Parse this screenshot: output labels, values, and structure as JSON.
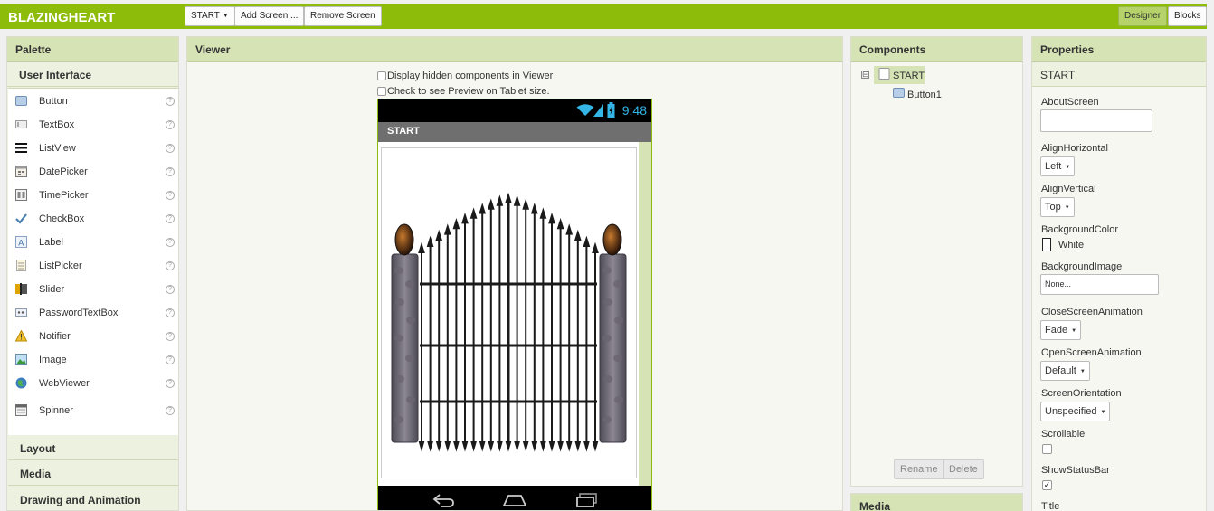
{
  "app": {
    "title": "BLAZINGHEART"
  },
  "toolbar": {
    "screen_select": "START",
    "add_screen": "Add Screen ...",
    "remove_screen": "Remove Screen",
    "designer": "Designer",
    "blocks": "Blocks"
  },
  "palette": {
    "header": "Palette",
    "category": "User Interface",
    "items": [
      {
        "label": "Button",
        "icon": "button-icon"
      },
      {
        "label": "TextBox",
        "icon": "textbox-icon"
      },
      {
        "label": "ListView",
        "icon": "listview-icon"
      },
      {
        "label": "DatePicker",
        "icon": "datepicker-icon"
      },
      {
        "label": "TimePicker",
        "icon": "timepicker-icon"
      },
      {
        "label": "CheckBox",
        "icon": "checkbox-icon"
      },
      {
        "label": "Label",
        "icon": "label-icon"
      },
      {
        "label": "ListPicker",
        "icon": "listpicker-icon"
      },
      {
        "label": "Slider",
        "icon": "slider-icon"
      },
      {
        "label": "PasswordTextBox",
        "icon": "password-icon"
      },
      {
        "label": "Notifier",
        "icon": "notifier-icon"
      },
      {
        "label": "Image",
        "icon": "image-icon"
      },
      {
        "label": "WebViewer",
        "icon": "webviewer-icon"
      },
      {
        "label": "Spinner",
        "icon": "spinner-icon"
      }
    ],
    "help_glyph": "?",
    "sections": [
      "Layout",
      "Media",
      "Drawing and Animation"
    ]
  },
  "viewer": {
    "header": "Viewer",
    "hidden_components_label": "Display hidden components in Viewer",
    "tablet_preview_label": "Check to see Preview on Tablet size.",
    "phone": {
      "time": "9:48",
      "screen_title": "START"
    }
  },
  "components": {
    "header": "Components",
    "tree_toggle": "⊟",
    "tree": {
      "root": "START",
      "children": [
        "Button1"
      ]
    },
    "rename": "Rename",
    "delete": "Delete"
  },
  "media": {
    "header": "Media"
  },
  "properties": {
    "header": "Properties",
    "component": "START",
    "about_screen": "AboutScreen",
    "align_horizontal": {
      "label": "AlignHorizontal",
      "value": "Left"
    },
    "align_vertical": {
      "label": "AlignVertical",
      "value": "Top"
    },
    "background_color": {
      "label": "BackgroundColor",
      "value": "White",
      "swatch": "#ffffff"
    },
    "background_image": {
      "label": "BackgroundImage",
      "value": "None..."
    },
    "close_screen_animation": {
      "label": "CloseScreenAnimation",
      "value": "Fade"
    },
    "open_screen_animation": {
      "label": "OpenScreenAnimation",
      "value": "Default"
    },
    "screen_orientation": {
      "label": "ScreenOrientation",
      "value": "Unspecified"
    },
    "scrollable": {
      "label": "Scrollable",
      "checked": false
    },
    "show_status_bar": {
      "label": "ShowStatusBar",
      "checked": true
    },
    "title": {
      "label": "Title"
    }
  },
  "colors": {
    "brand_green": "#8dbc0b",
    "panel_header": "#d5e3b5",
    "android_clock": "#33b5e5"
  }
}
